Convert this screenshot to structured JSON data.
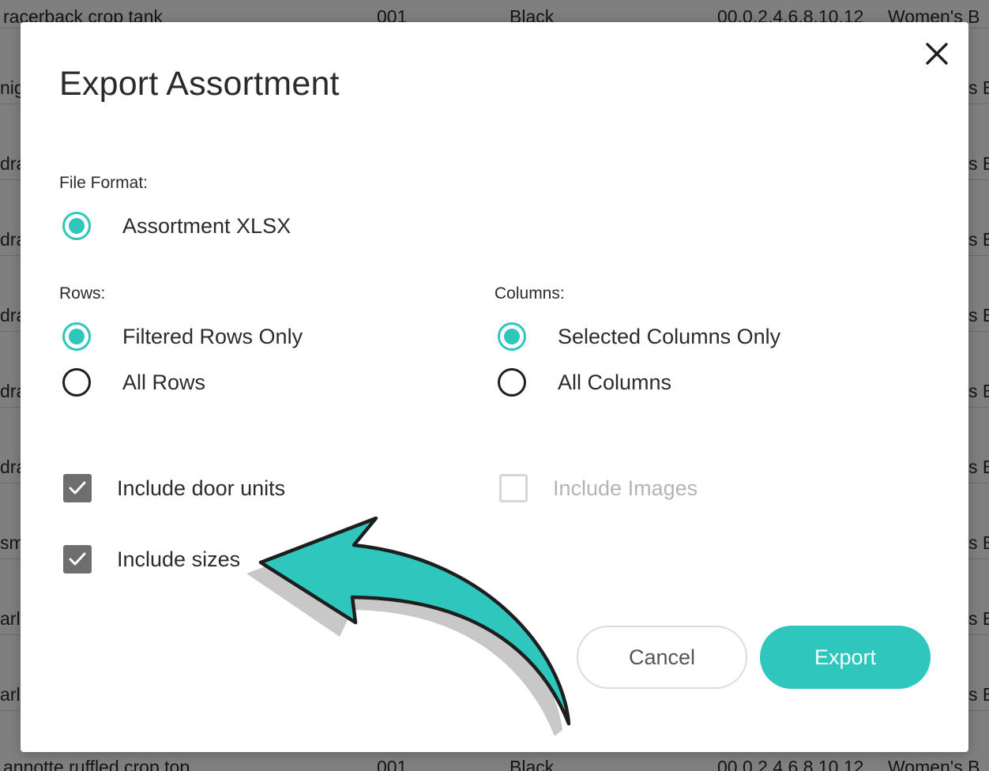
{
  "background_table": {
    "rows": [
      {
        "name": "racerback crop tank",
        "style": "001",
        "color": "Black",
        "sizes": "00,0,2,4,6,8,10,12",
        "category": "Women's B"
      },
      {
        "name": "nig",
        "style": "",
        "color": "",
        "sizes": "",
        "category": "s B"
      },
      {
        "name": "dra",
        "style": "",
        "color": "",
        "sizes": "",
        "category": "s B"
      },
      {
        "name": "dra",
        "style": "",
        "color": "",
        "sizes": "",
        "category": "s B"
      },
      {
        "name": "dra",
        "style": "",
        "color": "",
        "sizes": "",
        "category": "s B"
      },
      {
        "name": "dra",
        "style": "",
        "color": "",
        "sizes": "",
        "category": "s B"
      },
      {
        "name": "dra",
        "style": "",
        "color": "",
        "sizes": "",
        "category": "s B"
      },
      {
        "name": "sm",
        "style": "",
        "color": "",
        "sizes": "",
        "category": "s B"
      },
      {
        "name": "arl",
        "style": "",
        "color": "",
        "sizes": "",
        "category": "s B"
      },
      {
        "name": "arl",
        "style": "",
        "color": "",
        "sizes": "",
        "category": "s B"
      },
      {
        "name": "annotte ruffled crop top",
        "style": "001",
        "color": "Black",
        "sizes": "00,0,2,4,6,8,10,12",
        "category": "Women's B"
      }
    ]
  },
  "modal": {
    "title": "Export Assortment",
    "close_icon": "close-x-icon",
    "file_format": {
      "label": "File Format:",
      "options": [
        {
          "label": "Assortment XLSX",
          "selected": true
        }
      ]
    },
    "rows": {
      "label": "Rows:",
      "options": [
        {
          "label": "Filtered Rows Only",
          "selected": true
        },
        {
          "label": "All Rows",
          "selected": false
        }
      ]
    },
    "columns": {
      "label": "Columns:",
      "options": [
        {
          "label": "Selected Columns Only",
          "selected": true
        },
        {
          "label": "All Columns",
          "selected": false
        }
      ]
    },
    "checkboxes": [
      {
        "label": "Include door units",
        "checked": true,
        "disabled": false
      },
      {
        "label": "Include Images",
        "checked": false,
        "disabled": true
      },
      {
        "label": "Include sizes",
        "checked": true,
        "disabled": false
      }
    ],
    "buttons": {
      "cancel": "Cancel",
      "export": "Export"
    }
  },
  "colors": {
    "accent": "#2fc6be",
    "checkbox_checked": "#6e6e6e",
    "disabled_text": "#b4b4b4",
    "overlay": "rgba(0,0,0,0.5)"
  },
  "annotation": {
    "type": "curved-arrow",
    "points_to": "Include sizes",
    "color": "#2fc6be"
  }
}
